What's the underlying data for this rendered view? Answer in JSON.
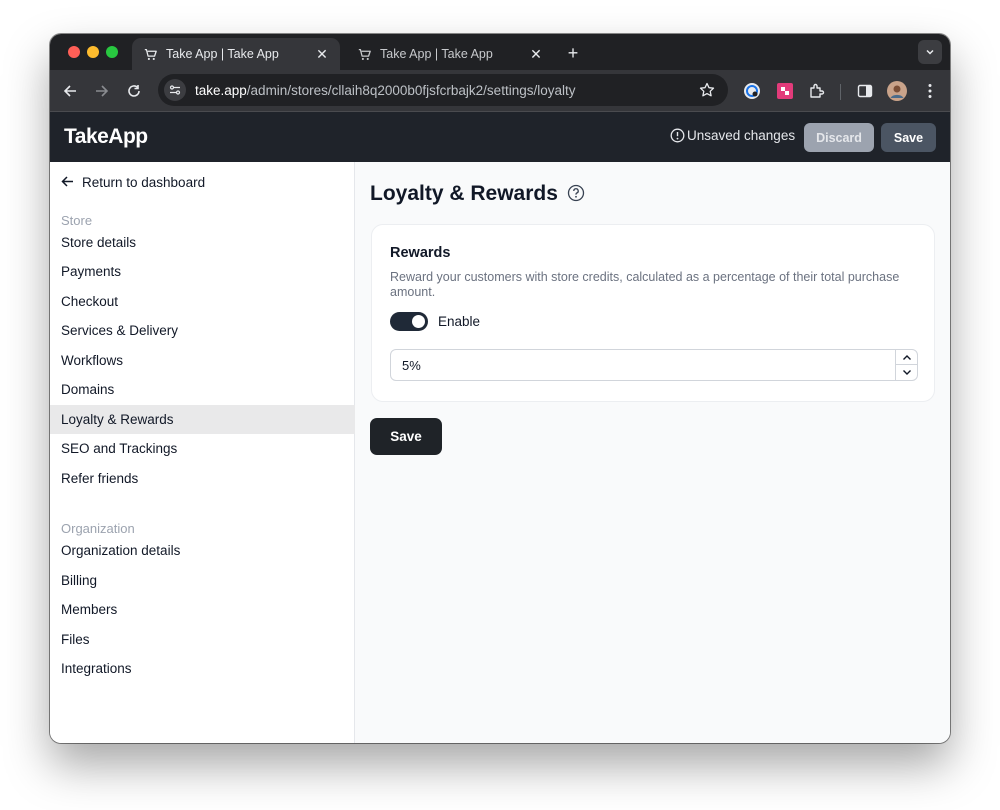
{
  "browser": {
    "tabs": [
      {
        "title": "Take App | Take App",
        "active": true
      },
      {
        "title": "Take App | Take App",
        "active": false
      }
    ],
    "url_host": "take.app",
    "url_path": "/admin/stores/cllaih8q2000b0fjsfcrbajk2/settings/loyalty"
  },
  "header": {
    "logo": "TakeApp",
    "unsaved": "Unsaved changes",
    "discard_label": "Discard",
    "save_label": "Save"
  },
  "sidebar": {
    "back_label": "Return to dashboard",
    "store_title": "Store",
    "store_items": [
      {
        "label": "Store details"
      },
      {
        "label": "Payments"
      },
      {
        "label": "Checkout"
      },
      {
        "label": "Services & Delivery"
      },
      {
        "label": "Workflows"
      },
      {
        "label": "Domains"
      },
      {
        "label": "Loyalty & Rewards",
        "active": true
      },
      {
        "label": "SEO and Trackings"
      },
      {
        "label": "Refer friends"
      }
    ],
    "org_title": "Organization",
    "org_items": [
      {
        "label": "Organization details"
      },
      {
        "label": "Billing"
      },
      {
        "label": "Members"
      },
      {
        "label": "Files"
      },
      {
        "label": "Integrations"
      }
    ]
  },
  "main": {
    "title": "Loyalty & Rewards",
    "card": {
      "title": "Rewards",
      "description": "Reward your customers with store credits, calculated as a percentage of their total purchase amount.",
      "toggle_label": "Enable",
      "toggle_on": true,
      "percent_value": "5%"
    },
    "save_label": "Save"
  },
  "colors": {
    "header_bg": "#1f232a",
    "active_nav_bg": "#e9e9ea",
    "primary_button": "#1f2328",
    "discard_button": "#9ca3af"
  }
}
